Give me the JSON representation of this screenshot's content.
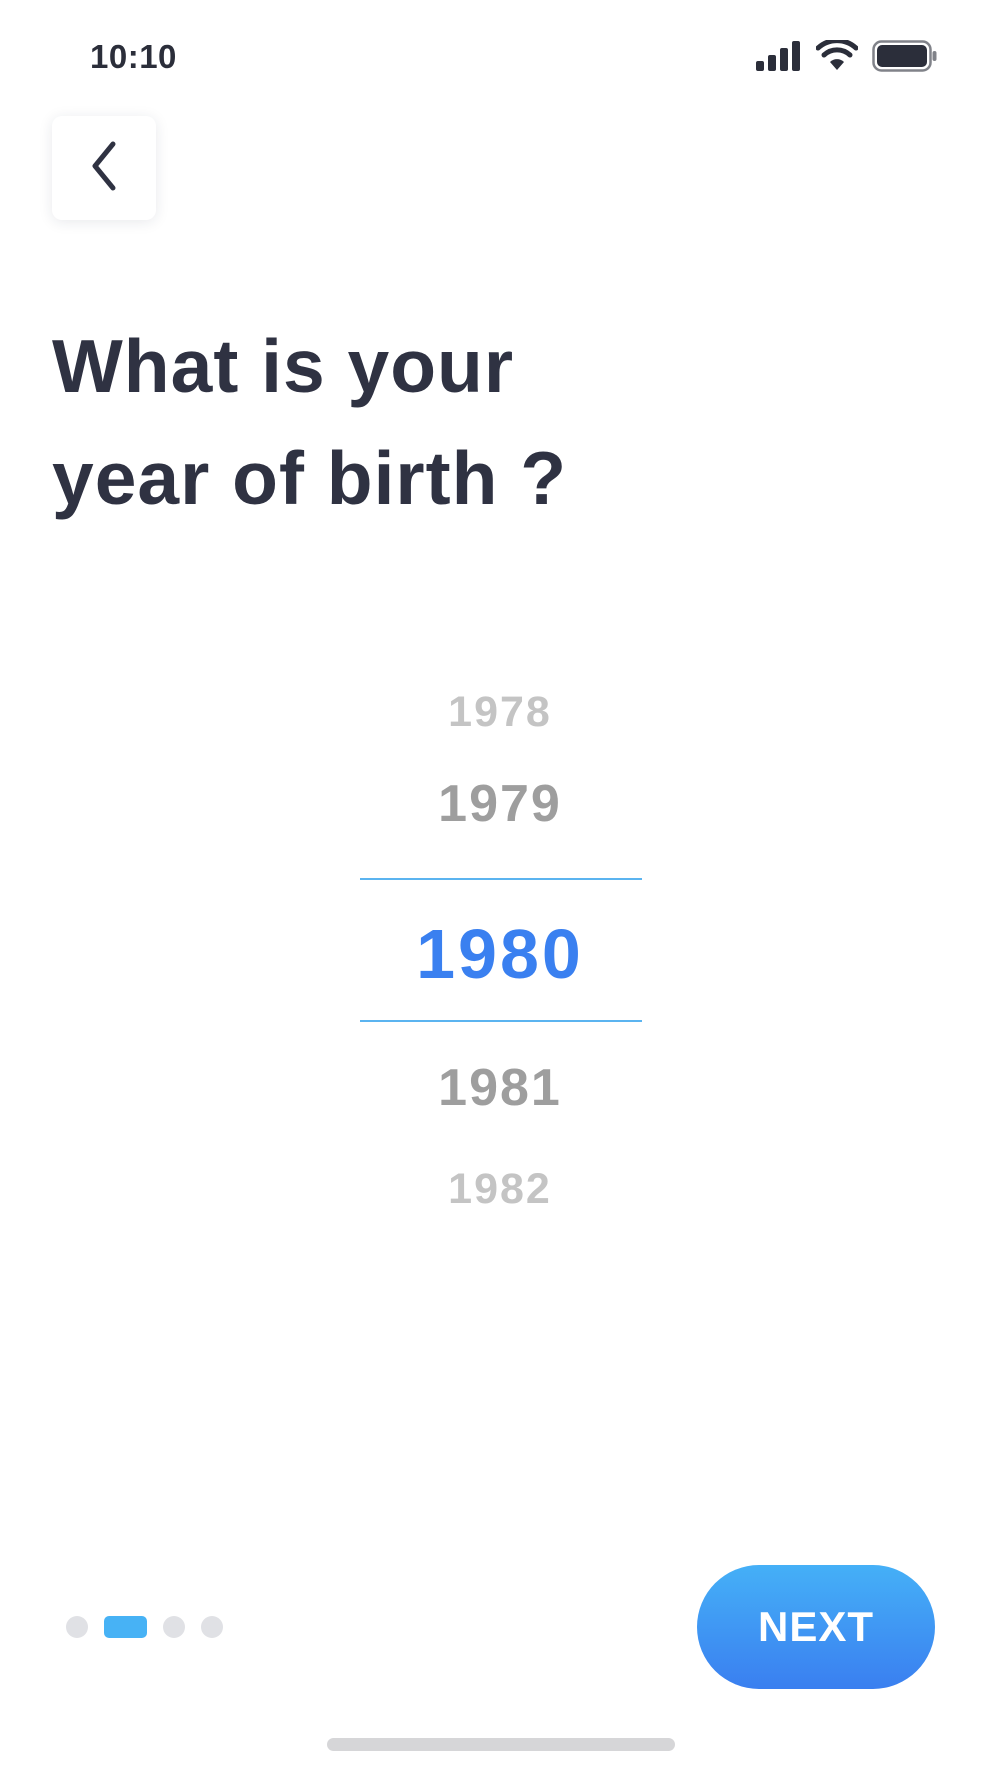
{
  "status_bar": {
    "time": "10:10",
    "icons": [
      "signal-icon",
      "wifi-icon",
      "battery-icon"
    ]
  },
  "header": {
    "back_icon": "chevron-left-icon"
  },
  "question": {
    "line1": "What is your",
    "line2": "year of birth ?"
  },
  "picker": {
    "options": [
      "1978",
      "1979",
      "1980",
      "1981",
      "1982"
    ],
    "selected": "1980"
  },
  "pagination": {
    "total": 4,
    "current": 2
  },
  "footer": {
    "next_label": "NEXT"
  },
  "colors": {
    "accent": "#3a80f0",
    "accent_light": "#47b2f5",
    "heading": "#2f3242",
    "muted": "#9e9e9e",
    "faint": "#c4c4c4"
  }
}
